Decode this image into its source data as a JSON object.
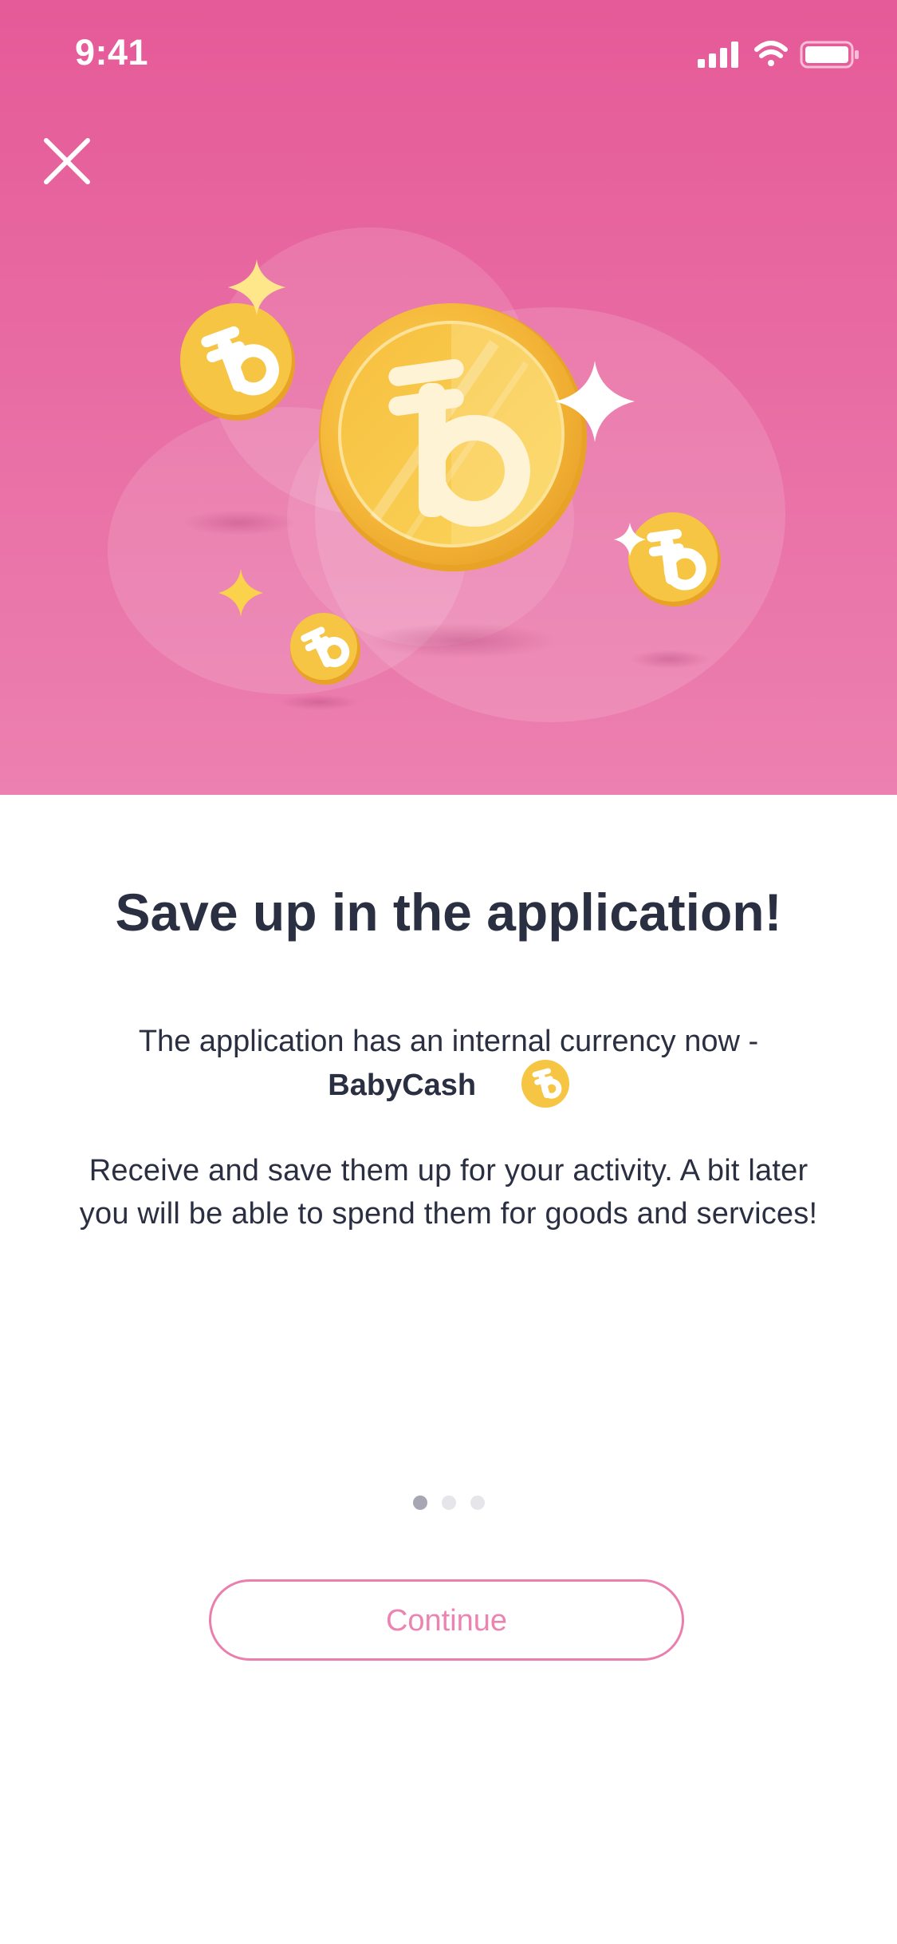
{
  "status_bar": {
    "time": "9:41"
  },
  "onboarding": {
    "title": "Save up in the application!",
    "intro_text": "The application has an internal currency now -",
    "currency_name": "BabyCash",
    "body_text": "Receive and save them up for your activity. A bit later you will be able to spend them for goods and services!",
    "pagination": {
      "total": 3,
      "current": 1
    },
    "continue_label": "Continue"
  },
  "icons": [
    "close-icon",
    "signal-icon",
    "wifi-icon",
    "battery-icon",
    "babycash-coin-icon",
    "sparkle-icon"
  ],
  "colors": {
    "hero_top": "#e55a98",
    "hero_bottom": "#ec80b0",
    "title_text": "#2b2f42",
    "button_accent": "#ea7fae",
    "coin_gold": "#f6c544"
  }
}
